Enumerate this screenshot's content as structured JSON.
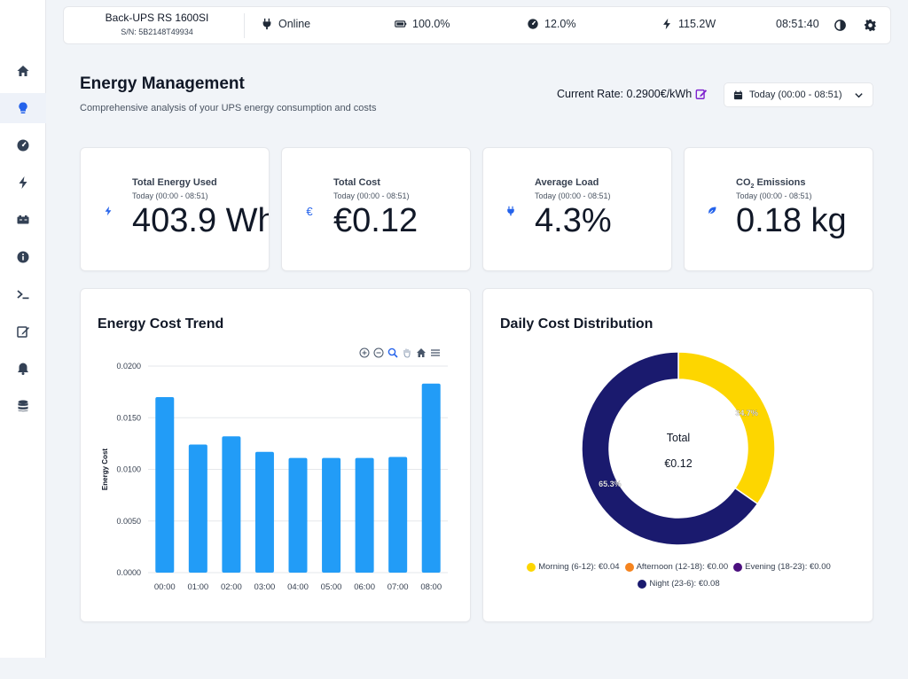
{
  "header": {
    "device_name": "Back-UPS RS 1600SI",
    "serial": "S/N: 5B2148T49934",
    "status": "Online",
    "battery": "100.0%",
    "load": "12.0%",
    "power": "115.2W",
    "time": "08:51:40"
  },
  "sidebar": {
    "items": [
      {
        "icon": "home-icon"
      },
      {
        "icon": "lightbulb-icon",
        "active": true
      },
      {
        "icon": "gauge-icon"
      },
      {
        "icon": "bolt-icon"
      },
      {
        "icon": "battery-icon"
      },
      {
        "icon": "info-icon"
      },
      {
        "icon": "terminal-icon"
      },
      {
        "icon": "edit-icon"
      },
      {
        "icon": "bell-icon"
      },
      {
        "icon": "database-icon"
      }
    ]
  },
  "page": {
    "title": "Energy Management",
    "subtitle": "Comprehensive analysis of your UPS energy consumption and costs",
    "rate": "Current Rate: 0.2900€/kWh",
    "range": "Today (00:00 - 08:51)"
  },
  "stats": [
    {
      "label": "Total Energy Used",
      "period": "Today (00:00 - 08:51)",
      "value": "403.9 Wh",
      "icon": "bolt-icon"
    },
    {
      "label": "Total Cost",
      "period": "Today (00:00 - 08:51)",
      "value": "€0.12",
      "icon": "euro-icon"
    },
    {
      "label": "Average Load",
      "period": "Today (00:00 - 08:51)",
      "value": "4.3%",
      "icon": "plug-icon"
    },
    {
      "label_main": "CO",
      "label_sub": "2",
      "label_rest": " Emissions",
      "period": "Today (00:00 - 08:51)",
      "value": "0.18 kg",
      "icon": "leaf-icon"
    }
  ],
  "colors": {
    "accent": "#2563eb",
    "bar": "#229cf7",
    "morning": "#fdd600",
    "afternoon": "#f5841f",
    "evening": "#4b0f7e",
    "night": "#1a1a6e"
  },
  "chart_data": [
    {
      "type": "bar",
      "title": "Energy Cost Trend",
      "categories": [
        "00:00",
        "01:00",
        "02:00",
        "03:00",
        "04:00",
        "05:00",
        "06:00",
        "07:00",
        "08:00"
      ],
      "values": [
        0.017,
        0.0124,
        0.0132,
        0.0117,
        0.0111,
        0.0111,
        0.0111,
        0.0112,
        0.0183
      ],
      "ylabel": "Energy Cost",
      "yticks": [
        "0.0000",
        "0.0050",
        "0.0100",
        "0.0150",
        "0.0200"
      ],
      "ylim": [
        0,
        0.02
      ],
      "grid": true
    },
    {
      "type": "pie",
      "title": "Daily Cost Distribution",
      "center_label": "Total",
      "center_value": "€0.12",
      "slices": [
        {
          "name": "Morning (6-12): €0.04",
          "value": 34.7,
          "label": "34.7%",
          "color": "#fdd600"
        },
        {
          "name": "Afternoon (12-18): €0.00",
          "value": 0,
          "label": "",
          "color": "#f5841f"
        },
        {
          "name": "Evening (18-23): €0.00",
          "value": 0,
          "label": "",
          "color": "#4b0f7e"
        },
        {
          "name": "Night (23-6): €0.08",
          "value": 65.3,
          "label": "65.3%",
          "color": "#1a1a6e"
        }
      ],
      "legend_position": "bottom"
    }
  ]
}
